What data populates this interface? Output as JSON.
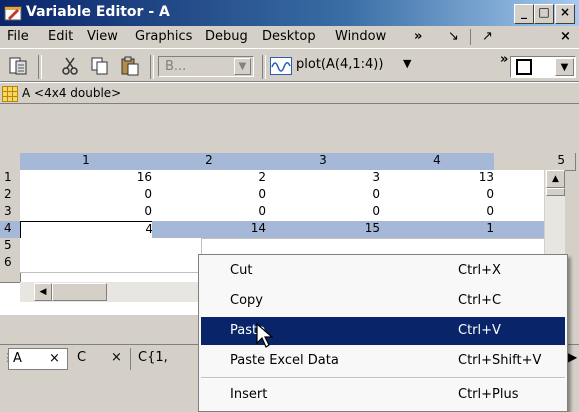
{
  "window": {
    "title": "Variable Editor - A"
  },
  "menubar": {
    "items": [
      "File",
      "Edit",
      "View",
      "Graphics",
      "Debug",
      "Desktop",
      "Window"
    ]
  },
  "toolbar": {
    "stack_value": "B...",
    "plot_label": "plot(A(4,1:4))"
  },
  "variable": {
    "label": "A <4x4 double>"
  },
  "grid": {
    "columns": [
      "1",
      "2",
      "3",
      "4",
      "5"
    ],
    "rows": [
      "1",
      "2",
      "3",
      "4",
      "5",
      "6"
    ],
    "cells": [
      [
        "16",
        "2",
        "3",
        "13"
      ],
      [
        "0",
        "0",
        "0",
        "0"
      ],
      [
        "0",
        "0",
        "0",
        "0"
      ],
      [
        "4",
        "14",
        "15",
        "1"
      ]
    ]
  },
  "tabs": [
    {
      "label": "A",
      "close": "×"
    },
    {
      "label": "C",
      "close": "×"
    },
    {
      "label": "C{1,"
    }
  ],
  "context_menu": {
    "items": [
      {
        "label": "Cut",
        "shortcut": "Ctrl+X"
      },
      {
        "label": "Copy",
        "shortcut": "Ctrl+C"
      },
      {
        "label": "Paste",
        "shortcut": "Ctrl+V"
      },
      {
        "label": "Paste Excel Data",
        "shortcut": "Ctrl+Shift+V"
      },
      {
        "label": "Insert",
        "shortcut": "Ctrl+Plus"
      }
    ]
  },
  "colors": {
    "titlebar": "#0a246a",
    "highlight": "#0a246a",
    "header_selected": "#a6b8d8",
    "face": "#d4d0c8"
  }
}
